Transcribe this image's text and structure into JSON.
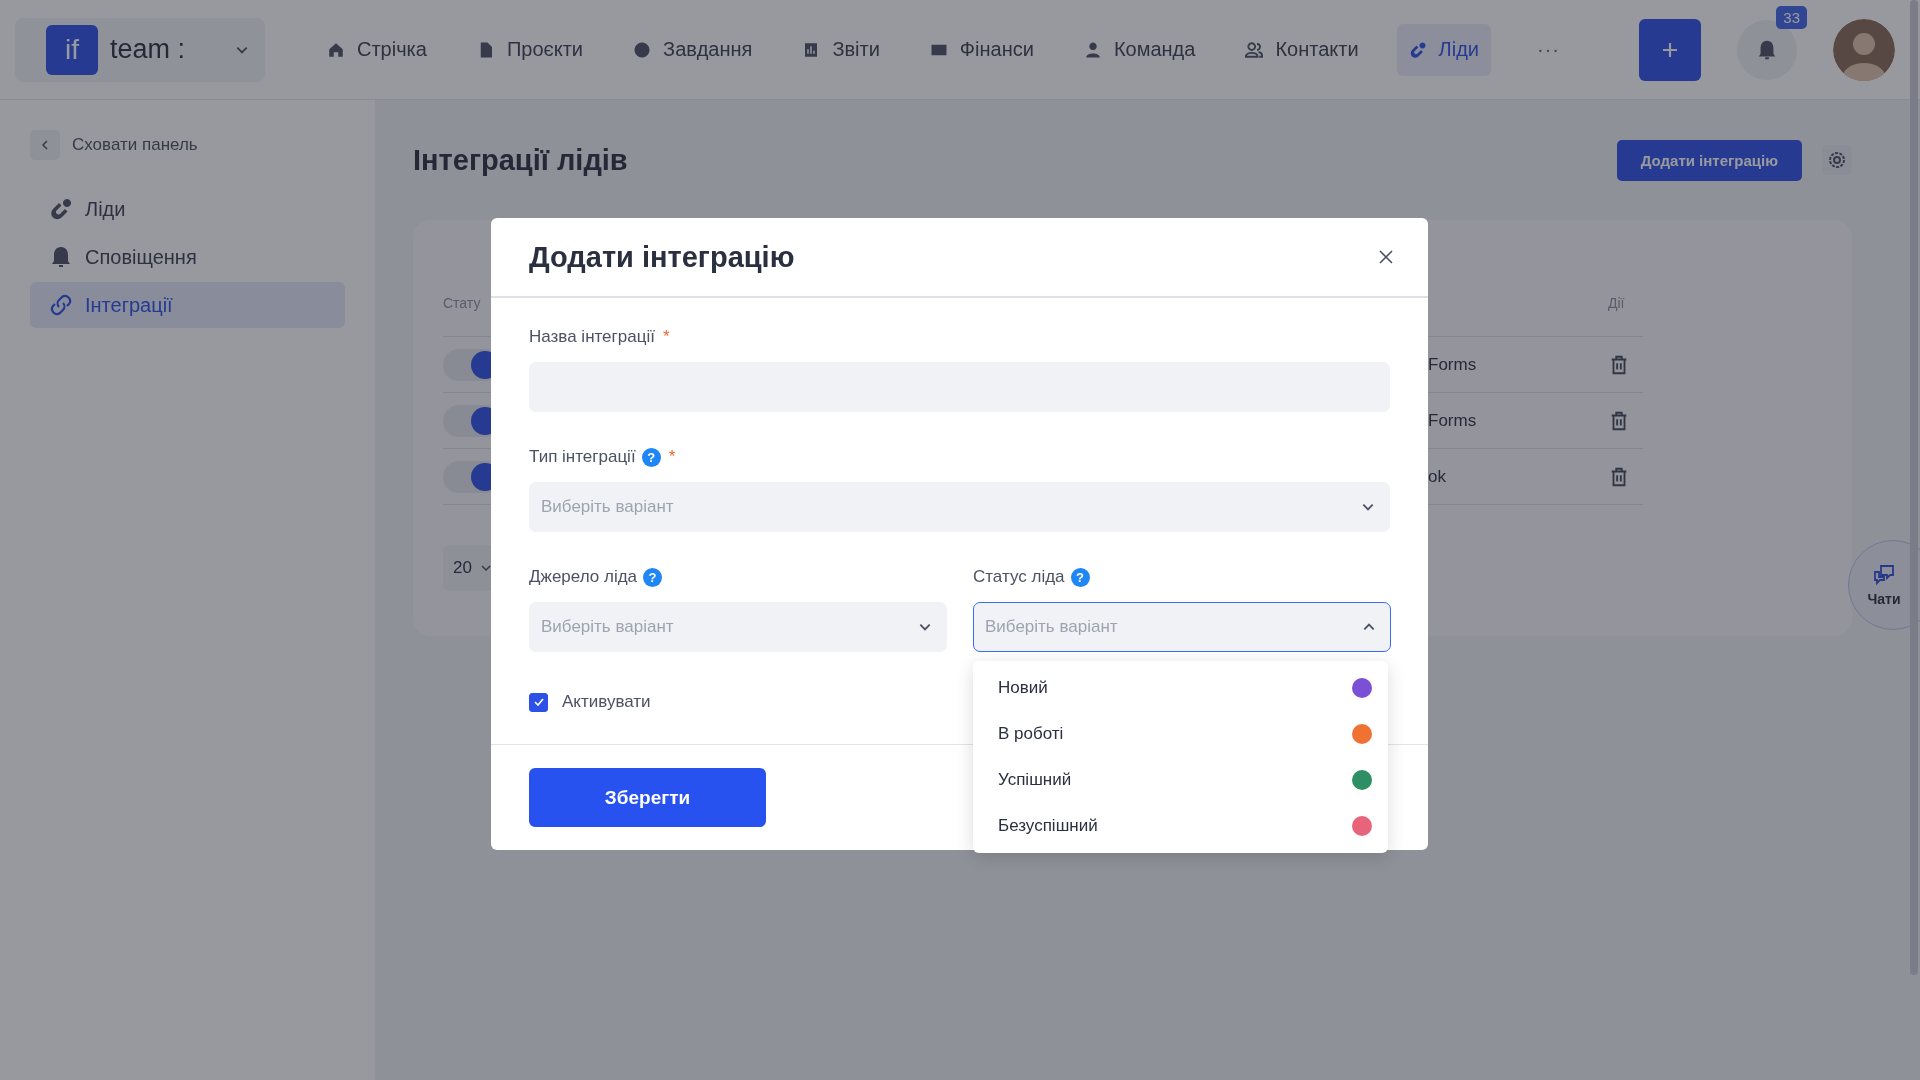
{
  "nav": {
    "logo_mark": "if",
    "workspace": "team :",
    "items": [
      {
        "label": "Стрічка",
        "selected": false
      },
      {
        "label": "Проєкти",
        "selected": false
      },
      {
        "label": "Завдання",
        "selected": false
      },
      {
        "label": "Звіти",
        "selected": false
      },
      {
        "label": "Фінанси",
        "selected": false
      },
      {
        "label": "Команда",
        "selected": false
      },
      {
        "label": "Контакти",
        "selected": false
      },
      {
        "label": "Ліди",
        "selected": true
      }
    ],
    "more": "···",
    "notifications_badge": "33"
  },
  "sidebar": {
    "hide_label": "Сховати панель",
    "items": [
      {
        "label": "Ліди",
        "selected": false
      },
      {
        "label": "Сповіщення",
        "selected": false
      },
      {
        "label": "Інтеграції",
        "selected": true
      }
    ]
  },
  "page": {
    "title": "Інтеграції лідів",
    "add_button": "Додати інтеграцію",
    "table": {
      "columns": [
        "Стату",
        "Дії"
      ],
      "rows": [
        {
          "on": true,
          "type": "Forms"
        },
        {
          "on": true,
          "type": "Forms"
        },
        {
          "on": true,
          "type": "ok"
        }
      ]
    },
    "page_size": "20"
  },
  "chat_button": "Чати",
  "modal": {
    "title": "Додати інтеграцію",
    "name_field": {
      "label": "Назва інтеграції",
      "required": "*"
    },
    "type_field": {
      "label": "Тип інтеграції",
      "help": "?",
      "required": "*",
      "placeholder": "Виберіть варіант",
      "open": false
    },
    "source_field": {
      "label": "Джерело ліда",
      "help": "?",
      "placeholder": "Виберіть варіант",
      "open": false
    },
    "status_field": {
      "label": "Статус ліда",
      "help": "?",
      "placeholder": "Виберіть варіант",
      "open": true,
      "options": [
        {
          "label": "Новий",
          "color": "#7b4fd6"
        },
        {
          "label": "В роботі",
          "color": "#ef7232"
        },
        {
          "label": "Успішний",
          "color": "#2e8f64"
        },
        {
          "label": "Безуспішний",
          "color": "#e8647a"
        }
      ]
    },
    "activate": {
      "label": "Активувати",
      "checked": true
    },
    "save_button": "Зберегти"
  }
}
